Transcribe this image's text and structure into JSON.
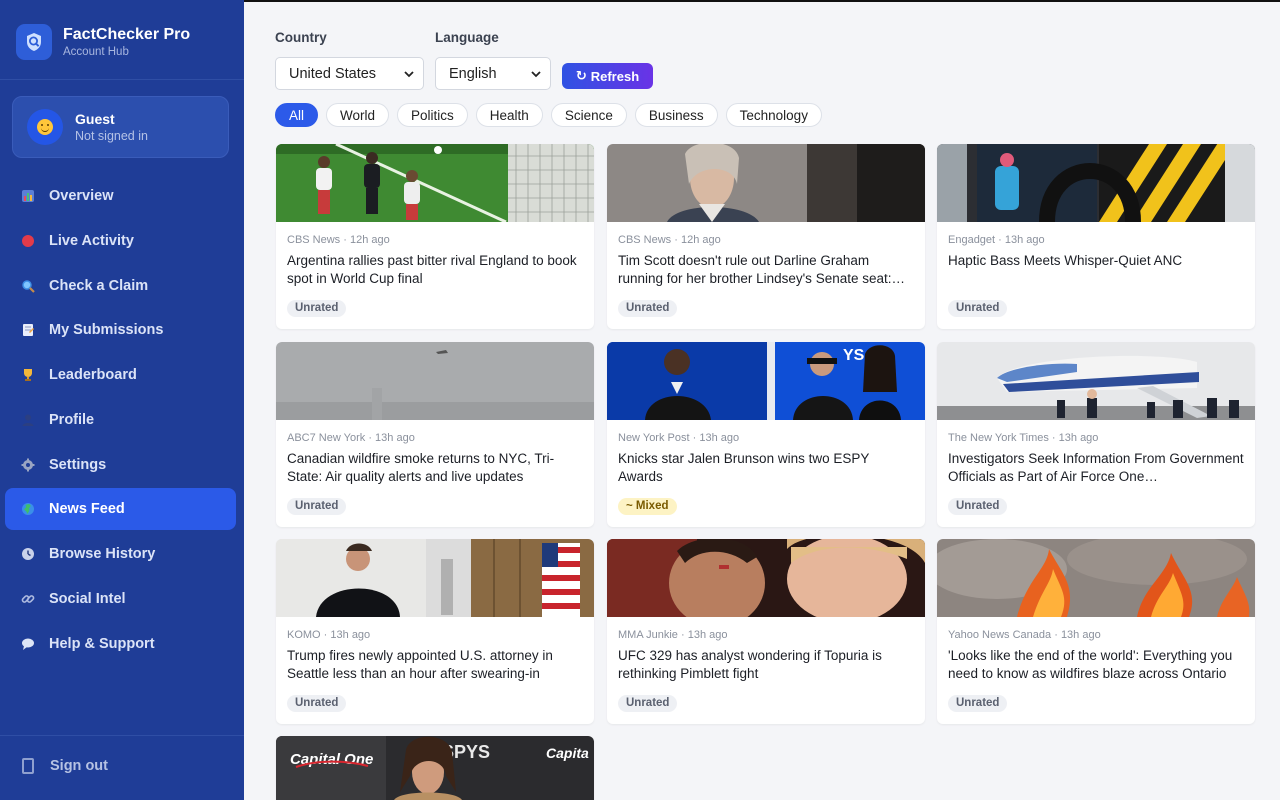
{
  "app": {
    "title": "FactChecker Pro",
    "subtitle": "Account Hub"
  },
  "user": {
    "name": "Guest",
    "status": "Not signed in"
  },
  "nav": [
    {
      "label": "Overview",
      "icon": "bar-chart-icon",
      "active": false
    },
    {
      "label": "Live Activity",
      "icon": "red-dot-icon",
      "active": false
    },
    {
      "label": "Check a Claim",
      "icon": "magnifier-icon",
      "active": false
    },
    {
      "label": "My Submissions",
      "icon": "document-icon",
      "active": false
    },
    {
      "label": "Leaderboard",
      "icon": "trophy-icon",
      "active": false
    },
    {
      "label": "Profile",
      "icon": "person-icon",
      "active": false
    },
    {
      "label": "Settings",
      "icon": "gear-icon",
      "active": false
    },
    {
      "label": "News Feed",
      "icon": "globe-icon",
      "active": true
    },
    {
      "label": "Browse History",
      "icon": "clock-icon",
      "active": false
    },
    {
      "label": "Social Intel",
      "icon": "link-icon",
      "active": false
    },
    {
      "label": "Help & Support",
      "icon": "speech-bubble-icon",
      "active": false
    }
  ],
  "signout_label": "Sign out",
  "filters": {
    "country_label": "Country",
    "country_value": "United States",
    "language_label": "Language",
    "language_value": "English",
    "refresh_label": "Refresh"
  },
  "tabs": [
    "All",
    "World",
    "Politics",
    "Health",
    "Science",
    "Business",
    "Technology"
  ],
  "active_tab": "All",
  "articles": [
    {
      "source": "CBS News",
      "time": "12h ago",
      "title": "Argentina rallies past bitter rival England to book spot in World Cup final",
      "rating": "Unrated",
      "image": "soccer-match-photo"
    },
    {
      "source": "CBS News",
      "time": "12h ago",
      "title": "Tim Scott doesn't rule out Darline Graham running for her brother Lindsey's Senate seat:…",
      "rating": "Unrated",
      "image": "portrait-photo"
    },
    {
      "source": "Engadget",
      "time": "13h ago",
      "title": "Haptic Bass Meets Whisper-Quiet ANC",
      "rating": "Unrated",
      "image": "headphones-display-photo"
    },
    {
      "source": "ABC7 New York",
      "time": "13h ago",
      "title": "Canadian wildfire smoke returns to NYC, Tri-State: Air quality alerts and live updates",
      "rating": "Unrated",
      "image": "hazy-skyline-photo"
    },
    {
      "source": "New York Post",
      "time": "13h ago",
      "title": "Knicks star Jalen Brunson wins two ESPY Awards",
      "rating": "~ Mixed",
      "image": "awards-red-carpet-photo"
    },
    {
      "source": "The New York Times",
      "time": "13h ago",
      "title": "Investigators Seek Information From Government Officials as Part of Air Force One…",
      "rating": "Unrated",
      "image": "air-force-one-photo"
    },
    {
      "source": "KOMO",
      "time": "13h ago",
      "title": "Trump fires newly appointed U.S. attorney in Seattle less than an hour after swearing-in",
      "rating": "Unrated",
      "image": "courtroom-photo"
    },
    {
      "source": "MMA Junkie",
      "time": "13h ago",
      "title": "UFC 329 has analyst wondering if Topuria is rethinking Pimblett fight",
      "rating": "Unrated",
      "image": "fighters-faceoff-photo"
    },
    {
      "source": "Yahoo News Canada",
      "time": "13h ago",
      "title": "'Looks like the end of the world': Everything you need to know as wildfires blaze across Ontario",
      "rating": "Unrated",
      "image": "wildfire-photo"
    },
    {
      "source": "",
      "time": "",
      "title": "",
      "rating": "",
      "image": "espys-red-carpet-photo"
    }
  ],
  "colors": {
    "sidebar": "#1f3d97",
    "active_nav": "#2b5ae8",
    "accent": "#2c5ae9",
    "mixed_badge": "#fdf3c4"
  }
}
